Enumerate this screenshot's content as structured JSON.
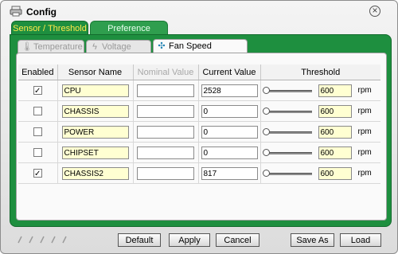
{
  "window": {
    "title": "Config",
    "close_icon": "close-icon"
  },
  "outer_tabs": [
    {
      "label": "Sensor / Threshold",
      "active": true
    },
    {
      "label": "Preference",
      "active": false
    }
  ],
  "sensor_tabs": [
    {
      "label": "Temperature",
      "icon": "thermometer-icon",
      "active": false
    },
    {
      "label": "Voltage",
      "icon": "lightning-icon",
      "active": false
    },
    {
      "label": "Fan Speed",
      "icon": "fan-icon",
      "active": true
    }
  ],
  "table": {
    "headers": [
      "Enabled",
      "Sensor Name",
      "Nominal Value",
      "Current Value",
      "Threshold"
    ],
    "rows": [
      {
        "enabled": true,
        "name": "CPU",
        "nominal": "",
        "current": "2528",
        "threshold": "600",
        "unit": "rpm"
      },
      {
        "enabled": false,
        "name": "CHASSIS",
        "nominal": "",
        "current": "0",
        "threshold": "600",
        "unit": "rpm"
      },
      {
        "enabled": false,
        "name": "POWER",
        "nominal": "",
        "current": "0",
        "threshold": "600",
        "unit": "rpm"
      },
      {
        "enabled": false,
        "name": "CHIPSET",
        "nominal": "",
        "current": "0",
        "threshold": "600",
        "unit": "rpm"
      },
      {
        "enabled": true,
        "name": "CHASSIS2",
        "nominal": "",
        "current": "817",
        "threshold": "600",
        "unit": "rpm"
      }
    ]
  },
  "buttons": {
    "default": "Default",
    "apply": "Apply",
    "cancel": "Cancel",
    "save_as": "Save As",
    "load": "Load"
  },
  "colors": {
    "accent_green": "#1e8f3f",
    "active_tab_text": "#ffe94a",
    "field_yellow": "#ffffd2"
  }
}
